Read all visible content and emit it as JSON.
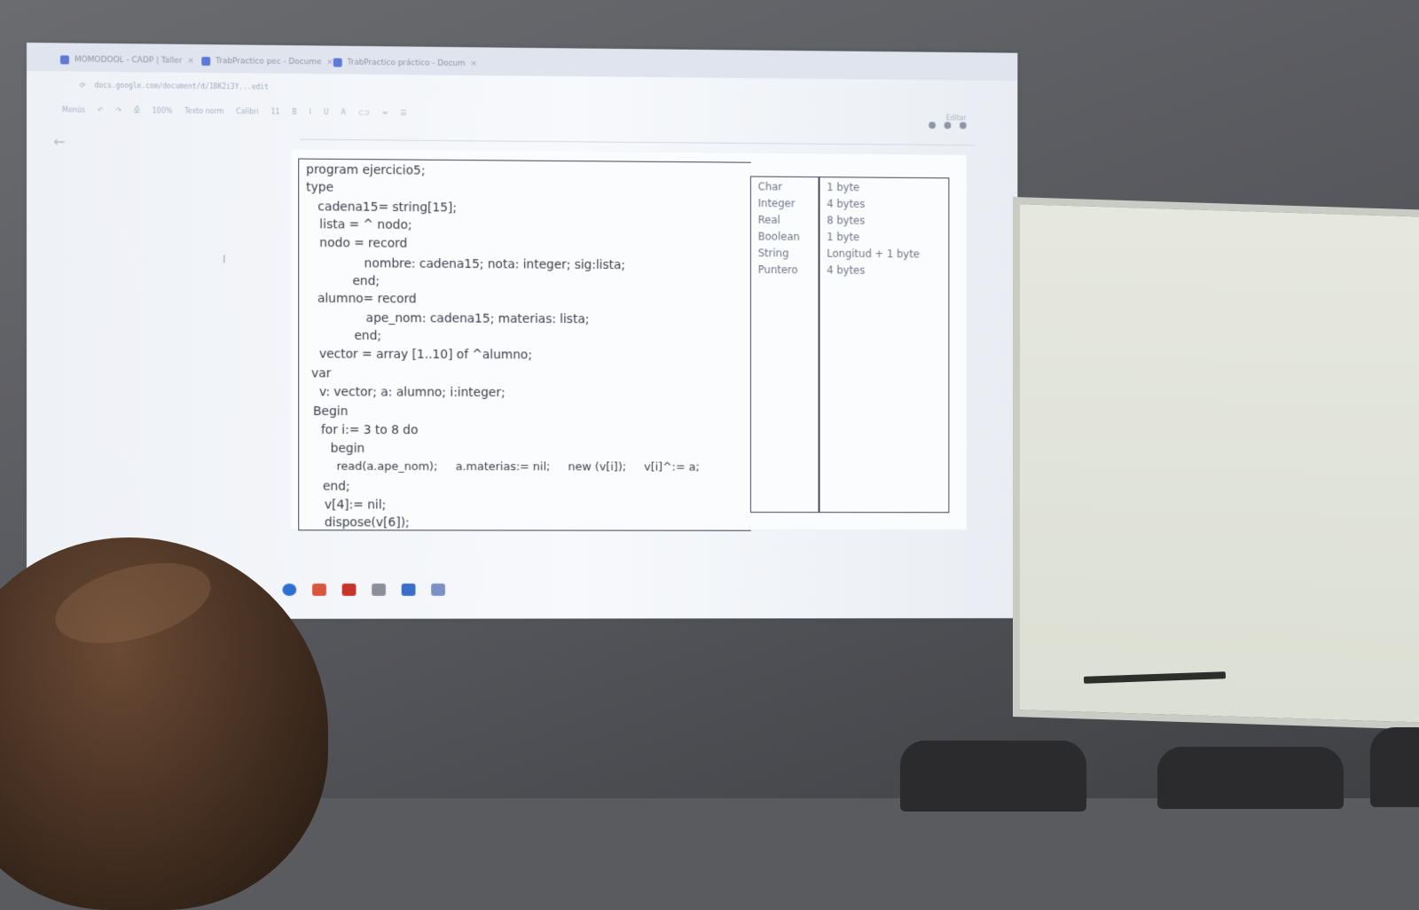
{
  "browser": {
    "tabs": [
      {
        "label": "MOMODOOL - CADP | Taller"
      },
      {
        "label": "TrabPractico pec - Docume"
      },
      {
        "label": "TrabPractico práctico - Docum"
      }
    ],
    "url": "docs.google.com/document/d/1BK2i3Y...edit"
  },
  "toolbar": {
    "menu": "Menús",
    "zoom": "100%",
    "style": "Texto norm",
    "font": "Calibri",
    "size": "11",
    "mode": "Editar"
  },
  "document": {
    "code_lines": [
      {
        "text": "program ejercicio5;"
      },
      {
        "text": "type"
      },
      {
        "text": "   cadena15= string[15];"
      },
      {
        "text": "   lista = ^ nodo;"
      },
      {
        "text": "   nodo = record"
      },
      {
        "text": "              nombre: cadena15; nota: integer; sig:lista;"
      },
      {
        "text": "           end;"
      },
      {
        "text": "  alumno= record"
      },
      {
        "text": "              ape_nom: cadena15; materias: lista;"
      },
      {
        "text": "           end;"
      },
      {
        "text": "  vector = array [1..10] of ^alumno;"
      },
      {
        "text": "var"
      },
      {
        "text": "  v: vector; a: alumno; i:integer;"
      },
      {
        "text": "Begin"
      },
      {
        "text": "  for i:= 3 to 8 do"
      },
      {
        "text": "    begin"
      },
      {
        "text": "      read(a.ape_nom);     a.materias:= nil;     new (v[i]);     v[i]^:= a;"
      },
      {
        "text": "  end;"
      },
      {
        "text": "  v[4]:= nil;"
      },
      {
        "text": "  dispose(v[6]);"
      }
    ],
    "type_table": [
      {
        "type": "Char",
        "size": "1 byte"
      },
      {
        "type": "Integer",
        "size": "4 bytes"
      },
      {
        "type": "Real",
        "size": "8 bytes"
      },
      {
        "type": "Boolean",
        "size": "1 byte"
      },
      {
        "type": "String",
        "size": "Longitud + 1 byte"
      },
      {
        "type": "Puntero",
        "size": "4 bytes"
      }
    ]
  }
}
